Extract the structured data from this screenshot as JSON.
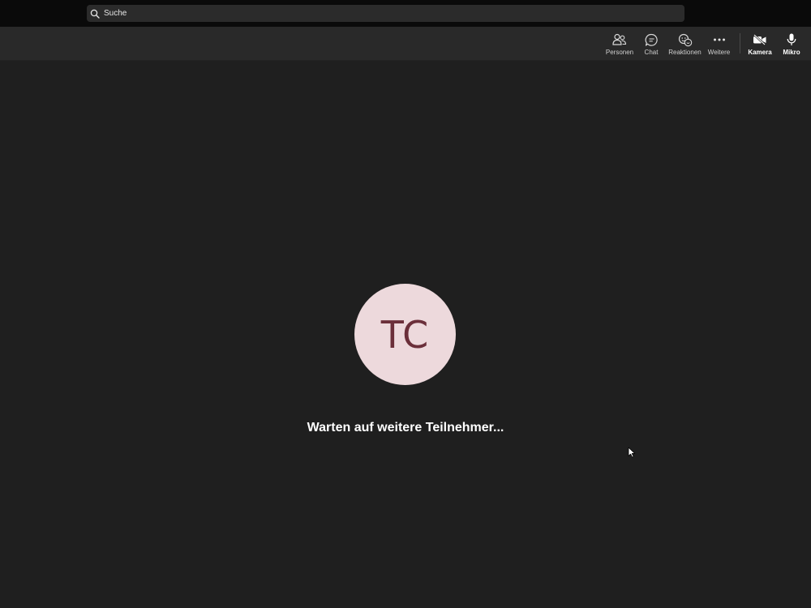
{
  "titlebar": {
    "search": {
      "placeholder": "Suche"
    }
  },
  "toolbar": {
    "items": [
      {
        "label": "Personen",
        "icon": "people-icon"
      },
      {
        "label": "Chat",
        "icon": "chat-icon"
      },
      {
        "label": "Reaktionen",
        "icon": "reactions-icon"
      },
      {
        "label": "Weitere",
        "icon": "more-icon"
      },
      {
        "label": "Kamera",
        "icon": "camera-off-icon"
      },
      {
        "label": "Mikro",
        "icon": "microphone-icon"
      }
    ]
  },
  "stage": {
    "avatar_initials": "TC",
    "waiting_text": "Warten auf weitere Teilnehmer..."
  },
  "colors": {
    "background": "#1f1f1f",
    "titlebar": "#0a0a0a",
    "toolbar": "#292929",
    "avatar_bg": "#edd9dc",
    "avatar_text": "#6b2f3a"
  }
}
